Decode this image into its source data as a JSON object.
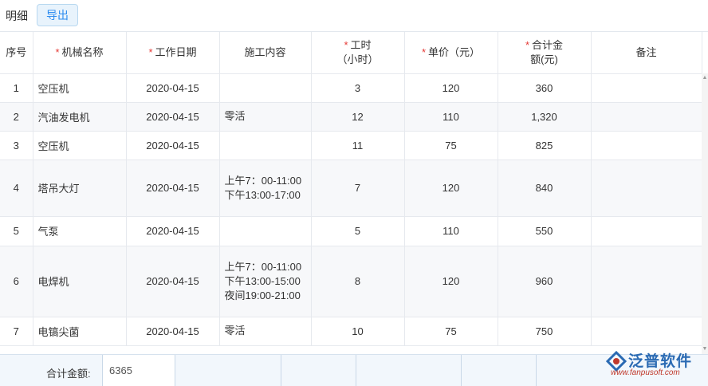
{
  "toolbar": {
    "tab_detail": "明细",
    "export_button": "导出"
  },
  "table": {
    "columns": [
      {
        "label": "序号",
        "required": false
      },
      {
        "label": "机械名称",
        "required": true
      },
      {
        "label": "工作日期",
        "required": true
      },
      {
        "label": "施工内容",
        "required": false
      },
      {
        "label": "工时（小时）",
        "required": true
      },
      {
        "label": "单价（元）",
        "required": true
      },
      {
        "label": "合计金额(元)",
        "required": true
      },
      {
        "label": "备注",
        "required": false
      }
    ],
    "rows": [
      {
        "no": "1",
        "machine": "空压机",
        "date": "2020-04-15",
        "content": "",
        "hours": "3",
        "price": "120",
        "amount": "360",
        "note": ""
      },
      {
        "no": "2",
        "machine": "汽油发电机",
        "date": "2020-04-15",
        "content": "零活",
        "hours": "12",
        "price": "110",
        "amount": "1,320",
        "note": ""
      },
      {
        "no": "3",
        "machine": "空压机",
        "date": "2020-04-15",
        "content": "",
        "hours": "11",
        "price": "75",
        "amount": "825",
        "note": ""
      },
      {
        "no": "4",
        "machine": "塔吊大灯",
        "date": "2020-04-15",
        "content": "上午7：00-11:00下午13:00-17:00",
        "hours": "7",
        "price": "120",
        "amount": "840",
        "note": ""
      },
      {
        "no": "5",
        "machine": "气泵",
        "date": "2020-04-15",
        "content": "",
        "hours": "5",
        "price": "110",
        "amount": "550",
        "note": ""
      },
      {
        "no": "6",
        "machine": "电焊机",
        "date": "2020-04-15",
        "content": "上午7：00-11:00下午13:00-15:00夜间19:00-21:00",
        "hours": "8",
        "price": "120",
        "amount": "960",
        "note": ""
      },
      {
        "no": "7",
        "machine": "电镐尖菌",
        "date": "2020-04-15",
        "content": "零活",
        "hours": "10",
        "price": "75",
        "amount": "750",
        "note": ""
      }
    ]
  },
  "footer": {
    "total_label": "合计金额:",
    "total_value": "6365"
  },
  "logo": {
    "brand": "泛普软件",
    "url": "www.fanpusoft.com"
  },
  "colors": {
    "accent": "#2d8cf0",
    "required": "#e53935",
    "footer_bg": "#f2f7fc"
  }
}
